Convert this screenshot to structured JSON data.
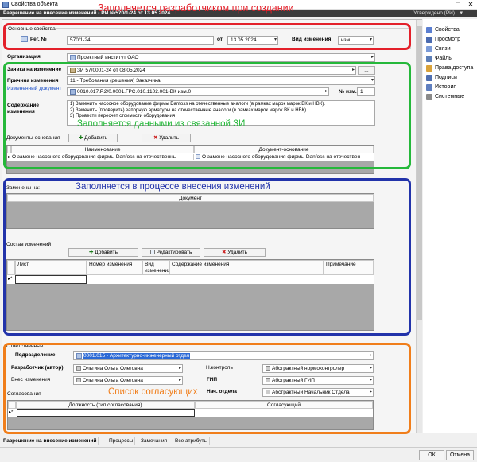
{
  "window": {
    "title": "Свойства объекта",
    "close": "✕"
  },
  "header": {
    "title": "Разрешение на внесение изменений - РИ №570/1-24 от 13.05.2024",
    "status": "Утверждено (РИ)",
    "status_arrow": "▾"
  },
  "sidebar": {
    "items": [
      {
        "label": "Свойства",
        "icon": "properties-icon",
        "color": "#5b7fd1"
      },
      {
        "label": "Просмотр",
        "icon": "view-icon",
        "color": "#4b6bb0"
      },
      {
        "label": "Связи",
        "icon": "links-icon",
        "color": "#7b9bd8"
      },
      {
        "label": "Файлы",
        "icon": "files-icon",
        "color": "#5d7fb8"
      },
      {
        "label": "Права доступа",
        "icon": "access-icon",
        "color": "#d9a23a"
      },
      {
        "label": "Подписи",
        "icon": "signatures-icon",
        "color": "#4f6fb0"
      },
      {
        "label": "История",
        "icon": "history-icon",
        "color": "#5f7fbf"
      },
      {
        "label": "Системные",
        "icon": "system-icon",
        "color": "#8a8a8a"
      }
    ]
  },
  "basic": {
    "legend": "Основные свойства",
    "reg_label": "Рег. №",
    "reg_value": "570/1-24",
    "date_label": "от",
    "date_value": "13.05.2024",
    "kind_label": "Вид изменения",
    "kind_value": "изм."
  },
  "org": {
    "label": "Организация",
    "value": "Проектный институт ОАО"
  },
  "request": {
    "label": "Заявка на изменение",
    "value": "ЗИ 57/0001-24 от 08.05.2024",
    "more": "..."
  },
  "reason": {
    "label": "Причина изменения",
    "value": "11 - Требования (решения) Заказчика"
  },
  "changed_doc": {
    "label": "Измененный документ",
    "value": "0010.017.Р.2/0.0001.ГРС.010.1102.001-ВК изм.0",
    "num_label": "№ изм.",
    "num_value": "1"
  },
  "content": {
    "label": "Содержание изменения",
    "lines": [
      "1) Заменить насосное оборудование фирмы Danfoss на отечественные аналоги (в рамках марок марок ВК и НВК).",
      "2) Заменить (проверить) запорную арматуры на отечественные аналоги (в рамках марок марок ВК и НВК).",
      "3) Провести пересчет стоимости оборудования"
    ]
  },
  "basis_docs": {
    "label": "Документы-основания",
    "add": "Добавить",
    "delete": "Удалить",
    "col_name": "Наименование",
    "col_doc": "Документ-основание",
    "rows": [
      {
        "name": "О замене насосного оборудования фирмы Danfoss на отечественны",
        "doc": "О замене насосного оборудования фирмы Danfoss на отечествен"
      }
    ]
  },
  "replaced": {
    "label": "Заменены на:",
    "col_doc": "Документ"
  },
  "changes": {
    "label": "Состав изменений",
    "add": "Добавить",
    "edit": "Редактировать",
    "delete": "Удалить",
    "columns": [
      "Лист",
      "Номер изменения",
      "Вид изменения",
      "Содержание изменения",
      "Примечание"
    ]
  },
  "responsible": {
    "legend": "Ответственные",
    "dept_label": "Подразделение",
    "dept_value": "0001.015 - Архитектурно-инженерный отдел",
    "dev_label": "Разработчик (автор)",
    "dev_value": "Ольгина Ольга Олеговна",
    "entered_label": "Внес изменения",
    "entered_value": "Ольгина Ольга Олеговна",
    "ncontrol_label": "Н.контроль",
    "ncontrol_value": "Абстрактный нормоконтролер",
    "gip_label": "ГИП",
    "gip_value": "Абстрактный ГИП",
    "head_label": "Нач. отдела",
    "head_value": "Абстрактный Начальник Отдела"
  },
  "approvals": {
    "label": "Согласования",
    "col_pos": "Должность (тип согласования)",
    "col_approve": "Согласующий"
  },
  "annotations": {
    "red": "Заполняется разработчиком при создании",
    "green": "Заполняется данными из связанной ЗИ",
    "blue": "Заполняется в процессе внесения изменений",
    "orange": "Список согласующих",
    "colors": {
      "red": "#e3202a",
      "green": "#25b83a",
      "blue": "#2233aa",
      "orange": "#f07e1b"
    }
  },
  "tabs": [
    "Разрешение на внесение изменений",
    "Процессы",
    "Замечания",
    "Все атрибуты"
  ],
  "footer": {
    "ok": "ОК",
    "cancel": "Отмена"
  }
}
